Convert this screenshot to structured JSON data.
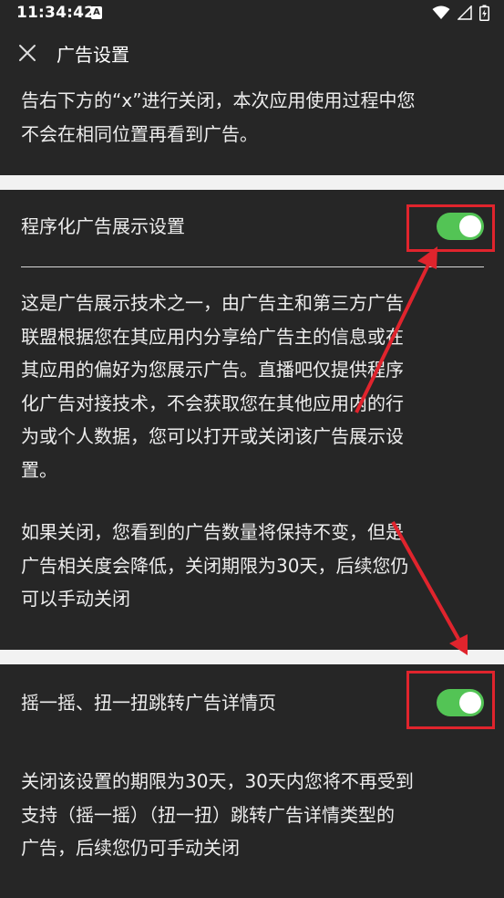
{
  "status_bar": {
    "time": "11:34:42",
    "a_badge": "A",
    "icons": [
      "wifi-icon",
      "signal-icon",
      "battery-icon"
    ]
  },
  "app_bar": {
    "title": "广告设置",
    "close_icon": "close-icon"
  },
  "intro_section": {
    "lines": [
      "告右下方的“x”进行关闭，本次应用使用过程中您",
      "不会在相同位置再看到广告。"
    ]
  },
  "programmatic_ads": {
    "title": "程序化广告展示设置",
    "toggle_on": true,
    "description_lines": [
      "这是广告展示技术之一，由广告主和第三方广告",
      "联盟根据您在其应用内分享给广告主的信息或在",
      "其应用的偏好为您展示广告。直播吧仅提供程序",
      "化广告对接技术，不会获取您在其他应用内的行",
      "为或个人数据，您可以打开或关闭该广告展示设",
      "置。"
    ],
    "note_lines": [
      "如果关闭，您看到的广告数量将保持不变，但是",
      "广告相关度会降低，关闭期限为30天，后续您仍",
      "可以手动关闭"
    ]
  },
  "shake_ads": {
    "title": "摇一摇、扭一扭跳转广告详情页",
    "toggle_on": true,
    "description_lines": [
      "关闭该设置的期限为30天，30天内您将不再受到",
      "支持（摇一摇）（扭一扭）跳转广告详情类型的",
      "广告，后续您仍可手动关闭"
    ]
  },
  "colors": {
    "panel_background": "#262626",
    "page_background": "#f2f2f2",
    "text": "#ededed",
    "toggle_on": "#53c455",
    "annotation_red": "#e0242d"
  }
}
